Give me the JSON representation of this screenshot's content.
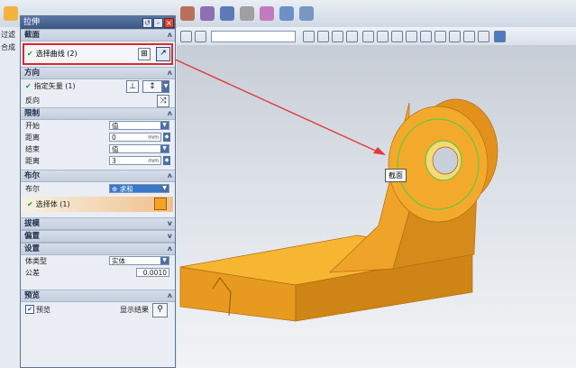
{
  "app": {
    "left_strip_labels": [
      "过滤",
      "合成"
    ]
  },
  "dialog": {
    "title": "拉伸",
    "section_section": "截面",
    "select_curve_label": "选择曲线",
    "select_curve_count": "(2)",
    "section_direction": "方向",
    "vector_label": "指定矢量",
    "vector_count": "(1)",
    "reverse_label": "反向",
    "section_limits": "限制",
    "start_label": "开始",
    "start_value": "值",
    "start_distance_label": "距离",
    "start_distance_value": "0",
    "end_label": "结束",
    "end_value": "值",
    "end_distance_label": "距离",
    "end_distance_value": "3",
    "unit": "mm",
    "section_boolean": "布尔",
    "boolean_label": "布尔",
    "boolean_value": "求和",
    "select_body_label": "选择体",
    "select_body_count": "(1)",
    "section_draft": "拔模",
    "section_offset": "偏置",
    "section_settings": "设置",
    "body_type_label": "体类型",
    "body_type_value": "实体",
    "tolerance_label": "公差",
    "tolerance_value": "0.0010",
    "section_preview": "预览",
    "preview_label": "预览",
    "show_result_label": "显示结果"
  },
  "viewport": {
    "section_tag": "截面"
  },
  "colors": {
    "part": "#f2a227",
    "highlight_border": "#d9292f",
    "arrow": "#e0393e",
    "title_bar": "#3d5784"
  }
}
